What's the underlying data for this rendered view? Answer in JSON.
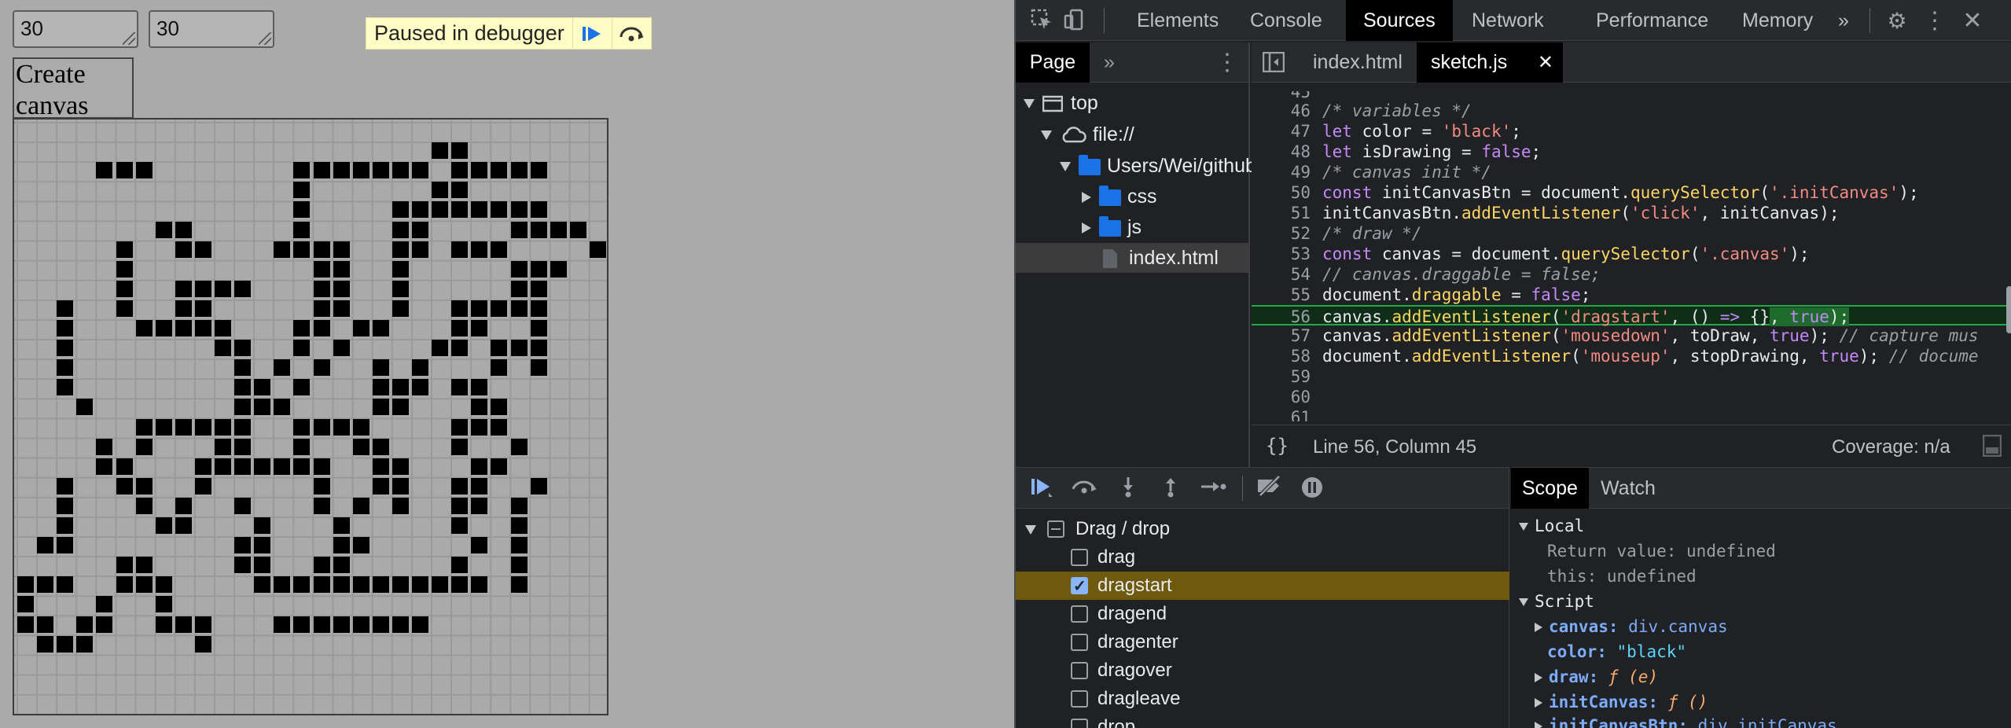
{
  "page": {
    "rows_value": "30",
    "cols_value": "30",
    "create_button": "Create canvas",
    "paused_text": "Paused in debugger",
    "canvas_cells": [
      [
        4,
        2
      ],
      [
        5,
        2
      ],
      [
        6,
        2
      ],
      [
        14,
        2
      ],
      [
        15,
        2
      ],
      [
        16,
        2
      ],
      [
        17,
        2
      ],
      [
        18,
        2
      ],
      [
        19,
        2
      ],
      [
        20,
        2
      ],
      [
        22,
        2
      ],
      [
        23,
        2
      ],
      [
        24,
        2
      ],
      [
        25,
        2
      ],
      [
        26,
        2
      ],
      [
        21,
        1
      ],
      [
        22,
        1
      ],
      [
        14,
        3
      ],
      [
        21,
        3
      ],
      [
        22,
        3
      ],
      [
        14,
        4
      ],
      [
        19,
        4
      ],
      [
        20,
        4
      ],
      [
        21,
        4
      ],
      [
        22,
        4
      ],
      [
        23,
        4
      ],
      [
        24,
        4
      ],
      [
        25,
        4
      ],
      [
        26,
        4
      ],
      [
        7,
        5
      ],
      [
        8,
        5
      ],
      [
        14,
        5
      ],
      [
        19,
        5
      ],
      [
        20,
        5
      ],
      [
        25,
        5
      ],
      [
        26,
        5
      ],
      [
        27,
        5
      ],
      [
        28,
        5
      ],
      [
        5,
        6
      ],
      [
        8,
        6
      ],
      [
        9,
        6
      ],
      [
        13,
        6
      ],
      [
        14,
        6
      ],
      [
        15,
        6
      ],
      [
        16,
        6
      ],
      [
        19,
        6
      ],
      [
        20,
        6
      ],
      [
        22,
        6
      ],
      [
        23,
        6
      ],
      [
        24,
        6
      ],
      [
        29,
        6
      ],
      [
        5,
        7
      ],
      [
        15,
        7
      ],
      [
        16,
        7
      ],
      [
        19,
        7
      ],
      [
        25,
        7
      ],
      [
        26,
        7
      ],
      [
        27,
        7
      ],
      [
        5,
        8
      ],
      [
        8,
        8
      ],
      [
        9,
        8
      ],
      [
        10,
        8
      ],
      [
        11,
        8
      ],
      [
        15,
        8
      ],
      [
        16,
        8
      ],
      [
        19,
        8
      ],
      [
        25,
        8
      ],
      [
        26,
        8
      ],
      [
        2,
        9
      ],
      [
        5,
        9
      ],
      [
        8,
        9
      ],
      [
        9,
        9
      ],
      [
        15,
        9
      ],
      [
        16,
        9
      ],
      [
        19,
        9
      ],
      [
        22,
        9
      ],
      [
        23,
        9
      ],
      [
        24,
        9
      ],
      [
        25,
        9
      ],
      [
        26,
        9
      ],
      [
        2,
        10
      ],
      [
        6,
        10
      ],
      [
        7,
        10
      ],
      [
        8,
        10
      ],
      [
        9,
        10
      ],
      [
        10,
        10
      ],
      [
        14,
        10
      ],
      [
        15,
        10
      ],
      [
        17,
        10
      ],
      [
        18,
        10
      ],
      [
        22,
        10
      ],
      [
        23,
        10
      ],
      [
        26,
        10
      ],
      [
        2,
        11
      ],
      [
        10,
        11
      ],
      [
        11,
        11
      ],
      [
        14,
        11
      ],
      [
        16,
        11
      ],
      [
        21,
        11
      ],
      [
        22,
        11
      ],
      [
        24,
        11
      ],
      [
        25,
        11
      ],
      [
        26,
        11
      ],
      [
        2,
        12
      ],
      [
        11,
        12
      ],
      [
        13,
        12
      ],
      [
        15,
        12
      ],
      [
        18,
        12
      ],
      [
        20,
        12
      ],
      [
        24,
        12
      ],
      [
        26,
        12
      ],
      [
        2,
        13
      ],
      [
        11,
        13
      ],
      [
        12,
        13
      ],
      [
        14,
        13
      ],
      [
        18,
        13
      ],
      [
        19,
        13
      ],
      [
        20,
        13
      ],
      [
        22,
        13
      ],
      [
        23,
        13
      ],
      [
        3,
        14
      ],
      [
        11,
        14
      ],
      [
        12,
        14
      ],
      [
        13,
        14
      ],
      [
        18,
        14
      ],
      [
        19,
        14
      ],
      [
        23,
        14
      ],
      [
        24,
        14
      ],
      [
        6,
        15
      ],
      [
        7,
        15
      ],
      [
        8,
        15
      ],
      [
        9,
        15
      ],
      [
        10,
        15
      ],
      [
        11,
        15
      ],
      [
        14,
        15
      ],
      [
        15,
        15
      ],
      [
        16,
        15
      ],
      [
        17,
        15
      ],
      [
        22,
        15
      ],
      [
        23,
        15
      ],
      [
        24,
        15
      ],
      [
        4,
        16
      ],
      [
        6,
        16
      ],
      [
        10,
        16
      ],
      [
        11,
        16
      ],
      [
        14,
        16
      ],
      [
        17,
        16
      ],
      [
        18,
        16
      ],
      [
        22,
        16
      ],
      [
        25,
        16
      ],
      [
        4,
        17
      ],
      [
        5,
        17
      ],
      [
        9,
        17
      ],
      [
        10,
        17
      ],
      [
        11,
        17
      ],
      [
        12,
        17
      ],
      [
        13,
        17
      ],
      [
        14,
        17
      ],
      [
        15,
        17
      ],
      [
        18,
        17
      ],
      [
        19,
        17
      ],
      [
        23,
        17
      ],
      [
        24,
        17
      ],
      [
        2,
        18
      ],
      [
        5,
        18
      ],
      [
        6,
        18
      ],
      [
        9,
        18
      ],
      [
        15,
        18
      ],
      [
        18,
        18
      ],
      [
        19,
        18
      ],
      [
        22,
        18
      ],
      [
        23,
        18
      ],
      [
        26,
        18
      ],
      [
        2,
        19
      ],
      [
        6,
        19
      ],
      [
        8,
        19
      ],
      [
        11,
        19
      ],
      [
        15,
        19
      ],
      [
        17,
        19
      ],
      [
        19,
        19
      ],
      [
        22,
        19
      ],
      [
        23,
        19
      ],
      [
        25,
        19
      ],
      [
        2,
        20
      ],
      [
        7,
        20
      ],
      [
        8,
        20
      ],
      [
        12,
        20
      ],
      [
        16,
        20
      ],
      [
        22,
        20
      ],
      [
        25,
        20
      ],
      [
        1,
        21
      ],
      [
        2,
        21
      ],
      [
        11,
        21
      ],
      [
        12,
        21
      ],
      [
        16,
        21
      ],
      [
        17,
        21
      ],
      [
        23,
        21
      ],
      [
        25,
        21
      ],
      [
        5,
        22
      ],
      [
        6,
        22
      ],
      [
        11,
        22
      ],
      [
        12,
        22
      ],
      [
        15,
        22
      ],
      [
        16,
        22
      ],
      [
        22,
        22
      ],
      [
        25,
        22
      ],
      [
        0,
        23
      ],
      [
        1,
        23
      ],
      [
        2,
        23
      ],
      [
        5,
        23
      ],
      [
        6,
        23
      ],
      [
        7,
        23
      ],
      [
        12,
        23
      ],
      [
        13,
        23
      ],
      [
        14,
        23
      ],
      [
        15,
        23
      ],
      [
        16,
        23
      ],
      [
        17,
        23
      ],
      [
        18,
        23
      ],
      [
        19,
        23
      ],
      [
        20,
        23
      ],
      [
        21,
        23
      ],
      [
        22,
        23
      ],
      [
        23,
        23
      ],
      [
        25,
        23
      ],
      [
        0,
        24
      ],
      [
        4,
        24
      ],
      [
        7,
        24
      ],
      [
        0,
        25
      ],
      [
        1,
        25
      ],
      [
        3,
        25
      ],
      [
        4,
        25
      ],
      [
        7,
        25
      ],
      [
        8,
        25
      ],
      [
        9,
        25
      ],
      [
        13,
        25
      ],
      [
        14,
        25
      ],
      [
        15,
        25
      ],
      [
        16,
        25
      ],
      [
        17,
        25
      ],
      [
        18,
        25
      ],
      [
        19,
        25
      ],
      [
        20,
        25
      ],
      [
        1,
        26
      ],
      [
        2,
        26
      ],
      [
        3,
        26
      ],
      [
        9,
        26
      ]
    ]
  },
  "devtools": {
    "tabs": [
      "Elements",
      "Console",
      "Sources",
      "Network",
      "Performance",
      "Memory"
    ],
    "active_tab": "Sources",
    "more_tabs_label": "»",
    "navigator": {
      "page_tab": "Page",
      "more_label": "»",
      "tree": [
        {
          "label": "top",
          "depth": 0,
          "kind": "frame"
        },
        {
          "label": "file://",
          "depth": 1,
          "kind": "cloud"
        },
        {
          "label": "Users/Wei/github",
          "depth": 2,
          "kind": "folder"
        },
        {
          "label": "css",
          "depth": 3,
          "kind": "folder"
        },
        {
          "label": "js",
          "depth": 3,
          "kind": "folder"
        },
        {
          "label": "index.html",
          "depth": 3,
          "kind": "file"
        }
      ]
    },
    "editor": {
      "file_tabs": [
        "index.html",
        "sketch.js"
      ],
      "active_file": "sketch.js",
      "status_position": "Line 56, Column 45",
      "coverage": "Coverage: n/a",
      "pretty_print_label": "{}"
    },
    "breakpoints": {
      "group_label": "Drag / drop",
      "items": [
        {
          "label": "drag",
          "checked": false
        },
        {
          "label": "dragstart",
          "checked": true
        },
        {
          "label": "dragend",
          "checked": false
        },
        {
          "label": "dragenter",
          "checked": false
        },
        {
          "label": "dragover",
          "checked": false
        },
        {
          "label": "dragleave",
          "checked": false
        },
        {
          "label": "drop",
          "checked": false
        }
      ]
    },
    "scope": {
      "tabs": [
        "Scope",
        "Watch"
      ],
      "active": "Scope",
      "local_label": "Local",
      "return_key": "Return value:",
      "return_val": "undefined",
      "this_key": "this:",
      "this_val": "undefined",
      "script_label": "Script",
      "canvas_key": "canvas:",
      "canvas_val": "div.canvas",
      "color_key": "color:",
      "color_val": "\"black\"",
      "draw_key": "draw:",
      "draw_val": "ƒ (e)",
      "initcanvas_key": "initCanvas:",
      "initcanvas_val": "ƒ ()",
      "initbtn_key": "initCanvasBtn:",
      "initbtn_val": "div.initCanvas"
    }
  }
}
